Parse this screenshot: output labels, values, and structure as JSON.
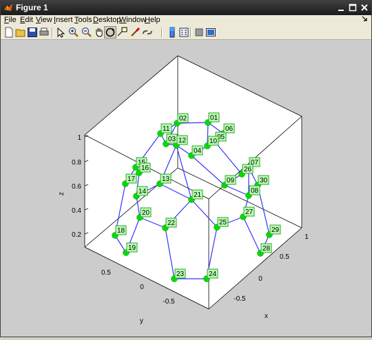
{
  "window": {
    "title": "Figure 1"
  },
  "menu": [
    {
      "label": "File",
      "ul": "F",
      "rest": "ile"
    },
    {
      "label": "Edit",
      "ul": "E",
      "rest": "dit"
    },
    {
      "label": "View",
      "ul": "V",
      "rest": "iew"
    },
    {
      "label": "Insert",
      "ul": "I",
      "rest": "nsert"
    },
    {
      "label": "Tools",
      "ul": "T",
      "rest": "ools"
    },
    {
      "label": "Desktop",
      "ul": "D",
      "rest": "esktop"
    },
    {
      "label": "Window",
      "ul": "W",
      "rest": "indow"
    },
    {
      "label": "Help",
      "ul": "H",
      "rest": "elp"
    }
  ],
  "toolbar": [
    "new-figure-icon",
    "open-file-icon",
    "save-icon",
    "print-icon",
    "edit-plot-icon",
    "zoom-in-icon",
    "zoom-out-icon",
    "pan-icon",
    "rotate-3d-icon",
    "data-cursor-icon",
    "brush-icon",
    "link-plot-icon",
    "colorbar-icon",
    "legend-icon",
    "hide-plot-tools-icon",
    "show-plot-tools-icon"
  ],
  "colors": {
    "marker": "#00dd00",
    "line": "#3333ff",
    "label_bg": "#b8ffb0",
    "label_border": "#30a030"
  },
  "axes": {
    "xlabel": "x",
    "ylabel": "y",
    "zlabel": "z",
    "z_ticks": [
      "1",
      "0.8",
      "0.6",
      "0.4",
      "0.2"
    ],
    "y_ticks": [
      "0.5",
      "0",
      "-0.5"
    ],
    "x_ticks": [
      "1",
      "0.5",
      "0",
      "-0.5"
    ]
  },
  "points": [
    {
      "label": "01"
    },
    {
      "label": "02"
    },
    {
      "label": "03"
    },
    {
      "label": "04"
    },
    {
      "label": "05"
    },
    {
      "label": "06"
    },
    {
      "label": "07"
    },
    {
      "label": "08"
    },
    {
      "label": "09"
    },
    {
      "label": "10"
    },
    {
      "label": "11"
    },
    {
      "label": "12"
    },
    {
      "label": "13"
    },
    {
      "label": "14"
    },
    {
      "label": "15"
    },
    {
      "label": "16"
    },
    {
      "label": "17"
    },
    {
      "label": "18"
    },
    {
      "label": "19"
    },
    {
      "label": "20"
    },
    {
      "label": "21"
    },
    {
      "label": "22"
    },
    {
      "label": "23"
    },
    {
      "label": "24"
    },
    {
      "label": "25"
    },
    {
      "label": "26"
    },
    {
      "label": "27"
    },
    {
      "label": "28"
    },
    {
      "label": "29"
    },
    {
      "label": "30"
    }
  ]
}
